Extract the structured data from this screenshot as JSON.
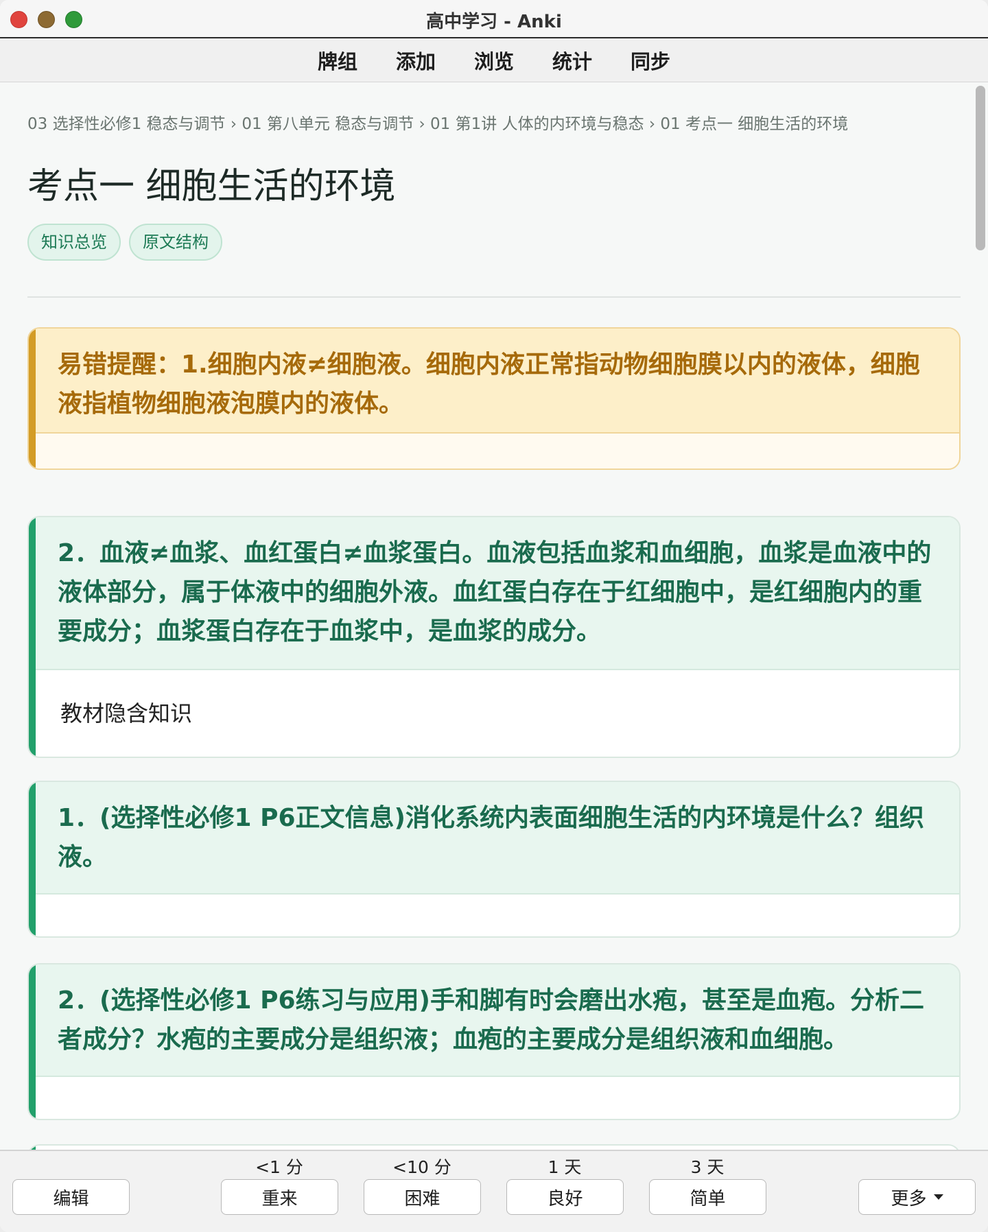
{
  "window": {
    "title": "高中学习 - Anki"
  },
  "toolbar": {
    "items": [
      "牌组",
      "添加",
      "浏览",
      "统计",
      "同步"
    ]
  },
  "breadcrumb": "03 选择性必修1 稳态与调节 › 01 第八单元 稳态与调节 › 01 第1讲 人体的内环境与稳态 › 01 考点一 细胞生活的环境",
  "page_title": "考点一 细胞生活的环境",
  "tags": [
    "知识总览",
    "原文结构"
  ],
  "cards": [
    {
      "head": "易错提醒：1.细胞内液≠细胞液。细胞内液正常指动物细胞膜以内的液体，细胞液指植物细胞液泡膜内的液体。",
      "body": ""
    },
    {
      "head": "2．血液≠血浆、血红蛋白≠血浆蛋白。血液包括血浆和血细胞，血浆是血液中的液体部分，属于体液中的细胞外液。血红蛋白存在于红细胞中，是红细胞内的重要成分；血浆蛋白存在于血浆中，是血浆的成分。",
      "body": "教材隐含知识"
    },
    {
      "head": "1．(选择性必修1 P6正文信息)消化系统内表面细胞生活的内环境是什么？组织液。",
      "body": ""
    },
    {
      "head": "2．(选择性必修1 P6练习与应用)手和脚有时会磨出水疱，甚至是血疱。分析二者成分？水疱的主要成分是组织液；血疱的主要成分是组织液和血细胞。",
      "body": ""
    }
  ],
  "bottom": {
    "edit": "编辑",
    "again": {
      "label": "重来",
      "interval": "<1 分"
    },
    "hard": {
      "label": "困难",
      "interval": "<10 分"
    },
    "good": {
      "label": "良好",
      "interval": "1 天"
    },
    "easy": {
      "label": "简单",
      "interval": "3 天"
    },
    "more": "更多"
  },
  "colors": {
    "accent_green": "#22a06b",
    "warn_orange": "#d39c26",
    "tag_green": "#1d7a55"
  }
}
